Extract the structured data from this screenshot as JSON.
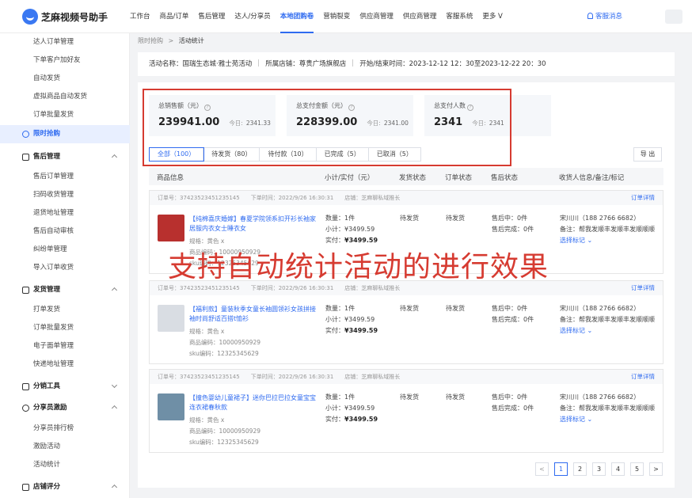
{
  "app": {
    "title": "芝麻视频号助手"
  },
  "nav": {
    "items": [
      "工作台",
      "商品/订单",
      "售后管理",
      "达人/分享员",
      "本地团购卷",
      "营销裂变",
      "供应商管理",
      "供应商管理",
      "客服系统",
      "更多 V"
    ],
    "active_index": 4,
    "service_label": "客服消息"
  },
  "sidebar": {
    "items": [
      "达人订单管理",
      "下单客户加好友",
      "自动发货",
      "虚拟商品自动发货",
      "订单批量发货"
    ],
    "active_item": "限时抢购",
    "groups": [
      {
        "label": "售后管理",
        "items": [
          "售后订单管理",
          "扫码收货管理",
          "退货地址管理",
          "售后自动审核",
          "纠纷单管理",
          "导入订单收货"
        ]
      },
      {
        "label": "发货管理",
        "items": [
          "打单发货",
          "订单批量发货",
          "电子面单管理",
          "快递地址管理"
        ]
      },
      {
        "label": "分销工具",
        "items": []
      },
      {
        "label": "分享员激励",
        "items": [
          "分享员排行榜",
          "激励活动",
          "活动统计"
        ]
      },
      {
        "label": "店铺评分",
        "items": []
      }
    ]
  },
  "breadcrumb": {
    "parent": "限时抢购",
    "separator": ">",
    "current": "活动统计"
  },
  "activity": {
    "name": "活动名称：国瑞生态城·雅士苑活动",
    "store": "所属店铺：尊贵广场旗舰店",
    "time": "开始/结束时间：2023-12-12 12：30至2023-12-22 20：30"
  },
  "stats": [
    {
      "label": "总销售额（元）",
      "value": "239941.00",
      "today_label": "今日:",
      "today_value": "2341.33"
    },
    {
      "label": "总支付金额（元）",
      "value": "228399.00",
      "today_label": "今日:",
      "today_value": "2341.00"
    },
    {
      "label": "总支付人数",
      "value": "2341",
      "today_label": "今日:",
      "today_value": "2341"
    }
  ],
  "tabs": [
    "全部（100）",
    "待发货（80）",
    "待付款（10）",
    "已完成（5）",
    "已取消（5）"
  ],
  "export_label": "导 出",
  "table": {
    "headers": [
      "商品信息",
      "小计/实付（元）",
      "发货状态",
      "订单状态",
      "售后状态",
      "收货人信息/备注/标记"
    ]
  },
  "orders": [
    {
      "order_no": "订单号：37423523451235145",
      "time": "下单时间：2022/9/26 16:30:31",
      "store": "店铺：芝麻聊私域推长",
      "detail_label": "订单详情",
      "product": "【纯棉喜庆婚嫁】春夏学院领系扣开衫长袖家居服内衣女士睡衣女",
      "spec": "规格：黄色 x",
      "code": "商品编码：10000950929",
      "sku": "sku编码：12325345629",
      "qty": "数量：1件",
      "subtotal": "小计：¥3499.59",
      "paid_label": "实付：",
      "paid_value": "¥3499.59",
      "ship_status": "待发货",
      "order_status": "待发货",
      "after_in": "售后中：0件",
      "after_done": "售后完成：0件",
      "receiver": "宋川川（188 2766 6682）",
      "remark": "备注：帮我发顺丰发顺丰发顺顺顺",
      "mark": "选择标记",
      "thumb_color": "#b8302e"
    },
    {
      "order_no": "订单号：37423523451235145",
      "time": "下单时间：2022/9/26 16:30:31",
      "store": "店铺：芝麻聊私域推长",
      "detail_label": "订单详情",
      "product": "【福利款】童装秋季女童长袖圆领衫女孩拼接袖时尚舒适百搭t恤衫",
      "spec": "规格：黄色 x",
      "code": "商品编码：10000950929",
      "sku": "sku编码：12325345629",
      "qty": "数量：1件",
      "subtotal": "小计：¥3499.59",
      "paid_label": "实付：",
      "paid_value": "¥3499.59",
      "ship_status": "待发货",
      "order_status": "待发货",
      "after_in": "售后中：0件",
      "after_done": "售后完成：0件",
      "receiver": "宋川川（188 2766 6682）",
      "remark": "备注：帮我发顺丰发顺丰发顺顺顺",
      "mark": "选择标记",
      "thumb_color": "#d9dde3"
    },
    {
      "order_no": "订单号：37423523451235145",
      "time": "下单时间：2022/9/26 16:30:31",
      "store": "店铺：芝麻聊私域推长",
      "detail_label": "订单详情",
      "product": "【撞色婴幼儿童裙子】迷你巴拉巴拉女童宝宝连衣裙春秋款",
      "spec": "规格：黄色 x",
      "code": "商品编码：10000950929",
      "sku": "sku编码：12325345629",
      "qty": "数量：1件",
      "subtotal": "小计：¥3499.59",
      "paid_label": "实付：",
      "paid_value": "¥3499.59",
      "ship_status": "待发货",
      "order_status": "待发货",
      "after_in": "售后中：0件",
      "after_done": "售后完成：0件",
      "receiver": "宋川川（188 2766 6682）",
      "remark": "备注：帮我发顺丰发顺丰发顺顺顺",
      "mark": "选择标记",
      "thumb_color": "#6f8fa6"
    }
  ],
  "overlay_text": "支持自动统计活动的进行效果",
  "pagination": {
    "prev": "<",
    "pages": [
      "1",
      "2",
      "3",
      "4",
      "5"
    ],
    "current": "1",
    "next": ">"
  },
  "colors": {
    "accent": "#2f6bf0",
    "annotation_red": "#d63b31"
  }
}
